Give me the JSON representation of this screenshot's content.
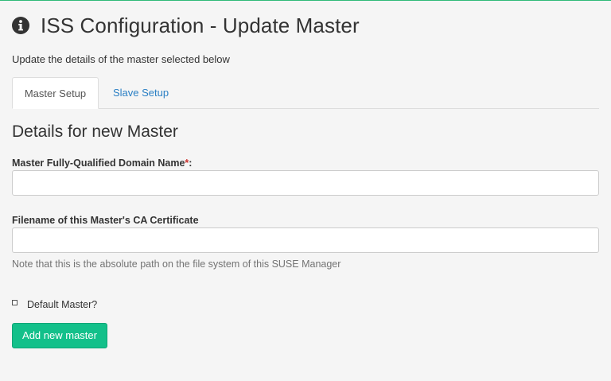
{
  "header": {
    "title": "ISS Configuration - Update Master",
    "icon": "info-circle-icon"
  },
  "subtitle": "Update the details of the master selected below",
  "tabs": [
    {
      "label": "Master Setup",
      "active": true
    },
    {
      "label": "Slave Setup",
      "active": false
    }
  ],
  "section_title": "Details for new Master",
  "form": {
    "fqdn": {
      "label": "Master Fully-Qualified Domain Name",
      "required_marker": "*",
      "suffix": ":",
      "value": ""
    },
    "ca_cert": {
      "label": "Filename of this Master's CA Certificate",
      "value": "",
      "help": "Note that this is the absolute path on the file system of this SUSE Manager"
    },
    "default_master": {
      "label": "Default Master?",
      "checked": false
    },
    "submit_label": "Add new master"
  },
  "colors": {
    "accent_line": "#30ba78",
    "button": "#13c08a",
    "link": "#2a7fc4",
    "required": "#c9302c"
  }
}
